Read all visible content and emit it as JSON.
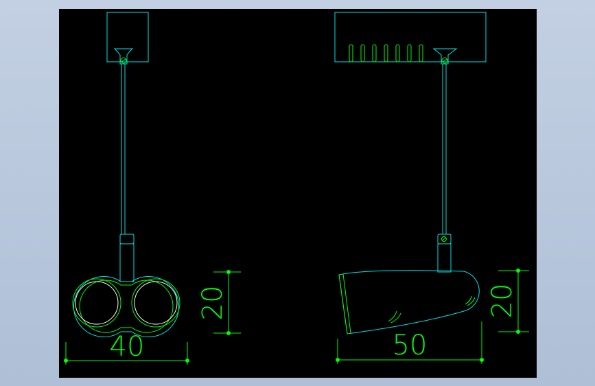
{
  "colors": {
    "background": "#000000",
    "outer_frame": "#b7c6dc",
    "geometry": "#00e5e5",
    "dimension": "#00ff00",
    "lamp_fill": "#ffffff"
  },
  "front_view": {
    "dimensions": {
      "width_label": "40",
      "height_label": "20"
    }
  },
  "side_view": {
    "dimensions": {
      "width_label": "50",
      "height_label": "20"
    }
  }
}
